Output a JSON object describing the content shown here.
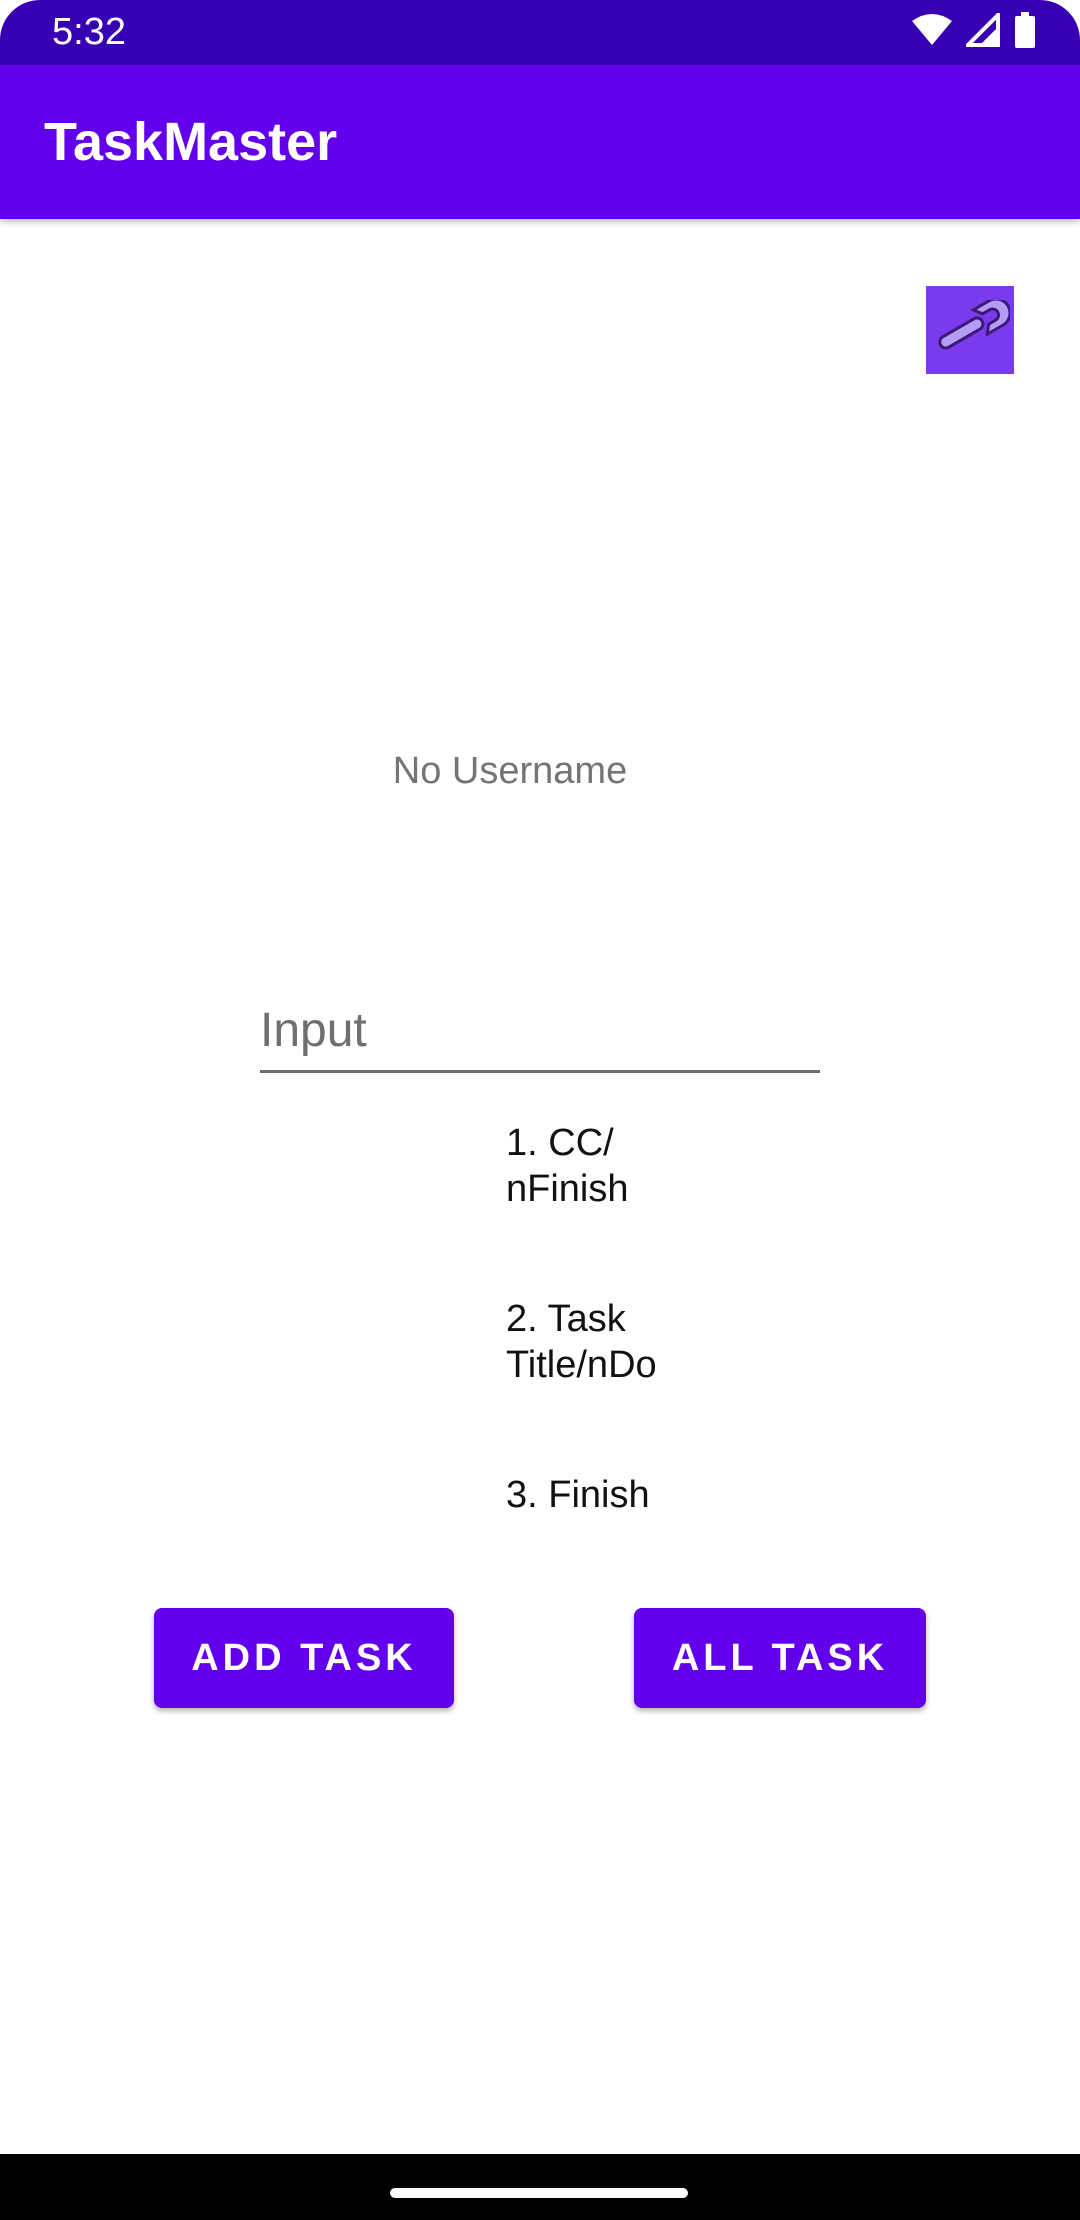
{
  "status_bar": {
    "time": "5:32",
    "icons": [
      "wifi-icon",
      "signal-icon",
      "battery-icon"
    ]
  },
  "app_bar": {
    "title": "TaskMaster"
  },
  "settings": {
    "icon": "wrench-icon"
  },
  "main": {
    "username": "No Username",
    "input_placeholder": "Input",
    "tasks": [
      "1. CC/\nnFinish",
      "2. Task\nTitle/nDo",
      "3. Finish"
    ],
    "add_task_label": "ADD TASK",
    "all_task_label": "ALL TASK"
  },
  "colors": {
    "status_bar": "#3700b3",
    "primary": "#6200ee",
    "settings_button": "#7c3aed"
  }
}
